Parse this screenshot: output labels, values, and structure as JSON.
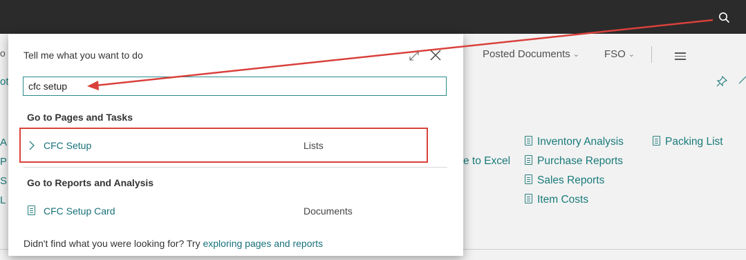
{
  "header": {
    "search_icon": "search-icon"
  },
  "background": {
    "nav": [
      {
        "label": "Posted Documents",
        "has_dropdown": true
      },
      {
        "label": "FSO",
        "has_dropdown": true
      }
    ],
    "links": {
      "col1": [
        "Inventory Analysis",
        "Purchase Reports",
        "Sales Reports",
        "Item Costs"
      ],
      "col2": [
        "Packing List"
      ],
      "partial": "e to Excel"
    },
    "edge_letters": [
      "A",
      "P",
      "S",
      "L"
    ],
    "edge_top": [
      "o",
      "ot"
    ]
  },
  "dialog": {
    "title": "Tell me what you want to do",
    "search_value": "cfc setup",
    "section1": "Go to Pages and Tasks",
    "result1": {
      "label": "CFC Setup",
      "type": "Lists"
    },
    "section2": "Go to Reports and Analysis",
    "result2": {
      "label": "CFC Setup Card",
      "type": "Documents"
    },
    "footer_text": "Didn't find what you were looking for? Try ",
    "footer_link": "exploring pages and reports"
  },
  "colors": {
    "accent": "#16707a",
    "highlight": "#d9413b",
    "topbar": "#2b2b2b"
  }
}
